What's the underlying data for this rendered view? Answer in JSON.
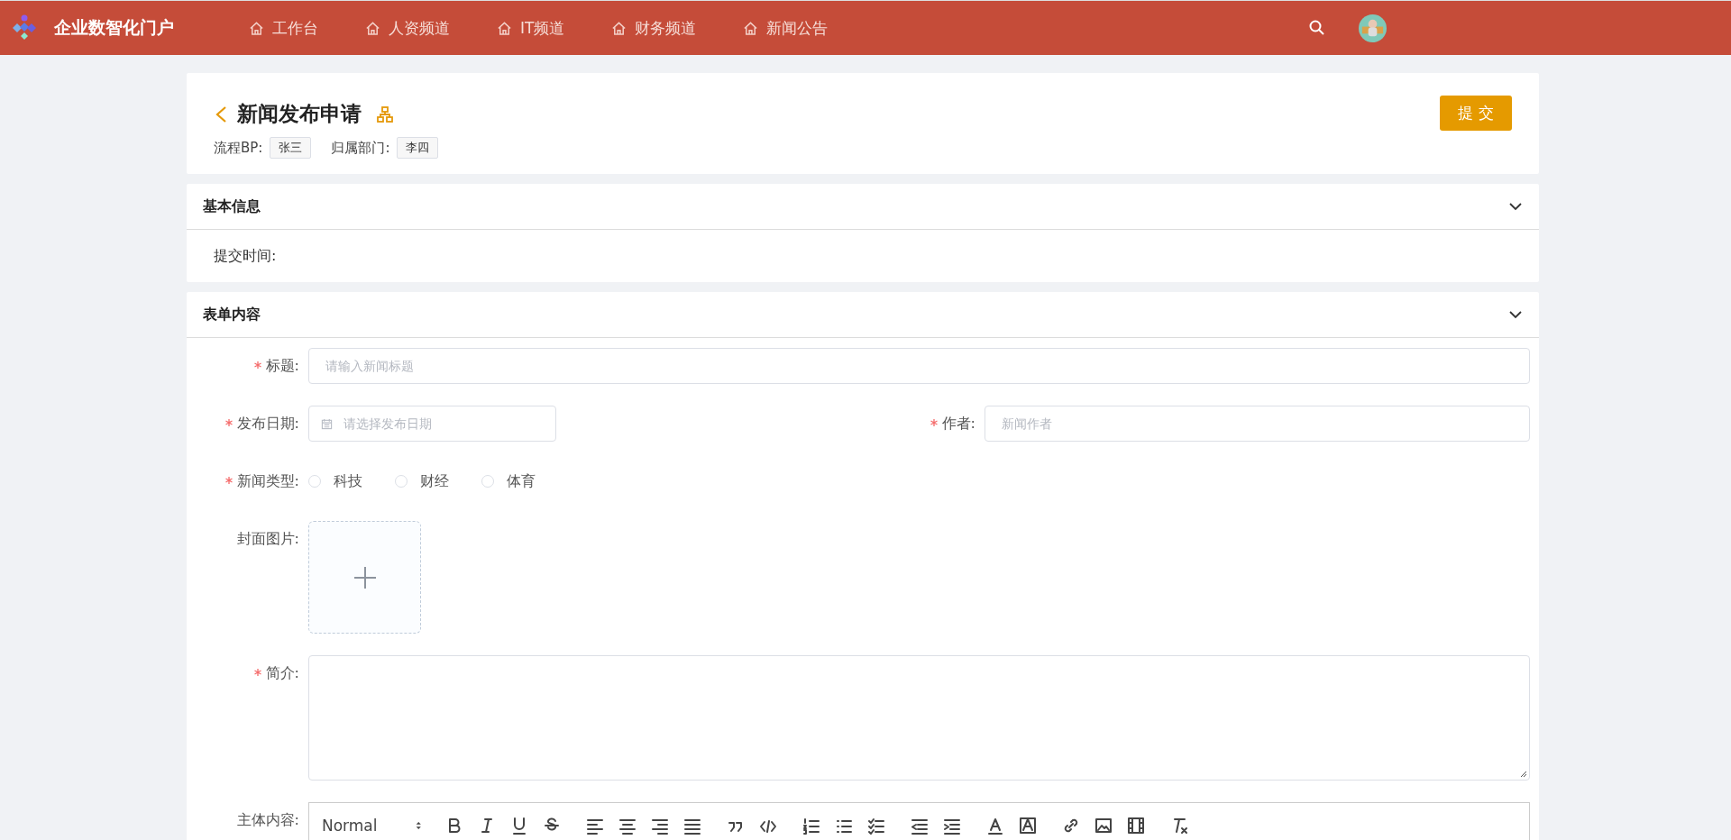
{
  "header": {
    "logo_text": "企业数智化门户",
    "nav": [
      {
        "label": "工作台"
      },
      {
        "label": "人资频道"
      },
      {
        "label": "IT频道"
      },
      {
        "label": "财务频道"
      },
      {
        "label": "新闻公告"
      }
    ]
  },
  "page": {
    "title": "新闻发布申请",
    "submit": "提 交",
    "meta": [
      {
        "label": "流程BP:",
        "value": "张三"
      },
      {
        "label": "归属部门:",
        "value": "李四"
      }
    ]
  },
  "basic": {
    "title": "基本信息",
    "fields": [
      {
        "label": "提交时间:"
      }
    ]
  },
  "form": {
    "title": "表单内容",
    "rows": [
      [
        {
          "kind": "text",
          "label": "标题:",
          "required": true,
          "placeholder": "请输入新闻标题"
        }
      ],
      [
        {
          "kind": "date",
          "label": "发布日期:",
          "required": true,
          "placeholder": "请选择发布日期"
        },
        {
          "kind": "text",
          "label": "作者:",
          "required": true,
          "placeholder": "新闻作者"
        }
      ],
      [
        {
          "kind": "radio",
          "label": "新闻类型:",
          "required": true,
          "options": [
            {
              "label": "科技",
              "selected": false
            },
            {
              "label": "财经",
              "selected": false
            },
            {
              "label": "体育",
              "selected": false
            }
          ]
        }
      ],
      [
        {
          "kind": "upload",
          "label": "封面图片:",
          "required": false
        }
      ],
      [
        {
          "kind": "textarea",
          "label": "简介:",
          "required": true
        }
      ],
      [
        {
          "kind": "editor",
          "label": "主体内容:",
          "required": false,
          "format": "Normal"
        }
      ]
    ]
  }
}
